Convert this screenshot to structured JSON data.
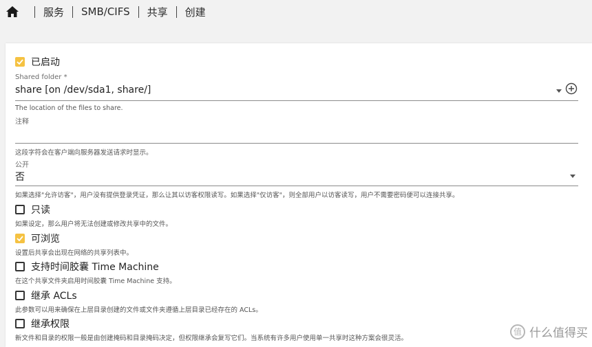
{
  "breadcrumb": {
    "home_icon": "home-icon",
    "items": [
      "服务",
      "SMB/CIFS",
      "共享",
      "创建"
    ]
  },
  "form": {
    "enabled": {
      "label": "已启动",
      "checked": true
    },
    "shared_folder": {
      "label": "Shared folder *",
      "value": "share [on /dev/sda1, share/]",
      "hint": "The location of the files to share."
    },
    "comment": {
      "label": "注释",
      "value": "",
      "hint": "这段字符会在客户端向服务器发送请求时显示。"
    },
    "public": {
      "label": "公开",
      "value": "否",
      "hint": "如果选择\"允许访客\"，用户没有提供登录凭证，那么让其以访客权限读写。如果选择\"仅访客\"，则全部用户以访客读写，用户不需要密码便可以连接共享。"
    },
    "read_only": {
      "label": "只读",
      "checked": false,
      "hint": "如果设定，那么用户将无法创建或修改共享中的文件。"
    },
    "browseable": {
      "label": "可浏览",
      "checked": true,
      "hint": "设置后共享会出现在网络的共享列表中。"
    },
    "time_machine": {
      "label": "支持时间胶囊 Time Machine",
      "checked": false,
      "hint": "在这个共享文件夹启用时间胶囊 Time Machine 支持。"
    },
    "inherit_acls": {
      "label": "继承 ACLs",
      "checked": false,
      "hint": "此参数可以用来确保在上层目录创建的文件或文件夹遵循上层目录已经存在的 ACLs。"
    },
    "inherit_permissions": {
      "label": "继承权限",
      "checked": false,
      "hint": "新文件和目录的权限一般是由创建掩码和目录掩码决定，但权限继承会复写它们。当系统有许多用户使用单一共享时这种方案会很灵活。"
    }
  },
  "watermark": {
    "text": "什么值得买",
    "logo_char": "值"
  },
  "colors": {
    "accent": "#f5c242",
    "background": "#f2f2f2",
    "card": "#ffffff"
  }
}
